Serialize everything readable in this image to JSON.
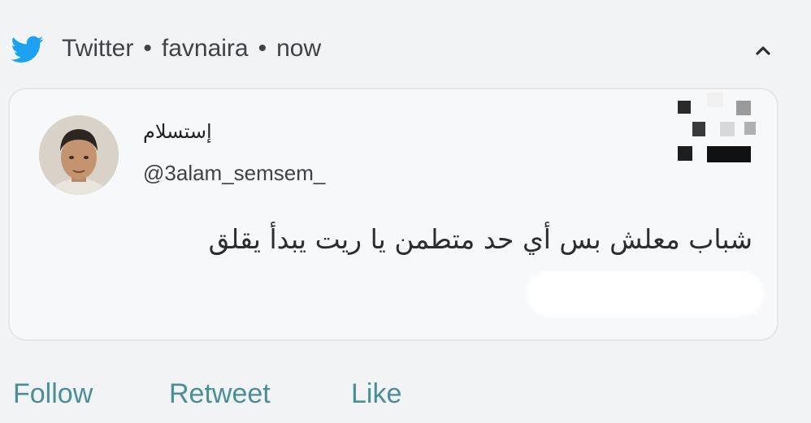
{
  "notification": {
    "app_name": "Twitter",
    "account": "favnaira",
    "time": "now",
    "separator": "•",
    "icons": {
      "app": "twitter-bird-icon",
      "collapse": "chevron-up-icon"
    },
    "colors": {
      "brand": "#1da1f2",
      "action_text": "#4a8f96"
    }
  },
  "tweet": {
    "display_name": "إستسلام",
    "handle": "@3alam_semsem_",
    "text": "شباب معلش بس أي حد متطمن يا ريت يبدأ يقلق"
  },
  "actions": {
    "follow": "Follow",
    "retweet": "Retweet",
    "like": "Like"
  }
}
